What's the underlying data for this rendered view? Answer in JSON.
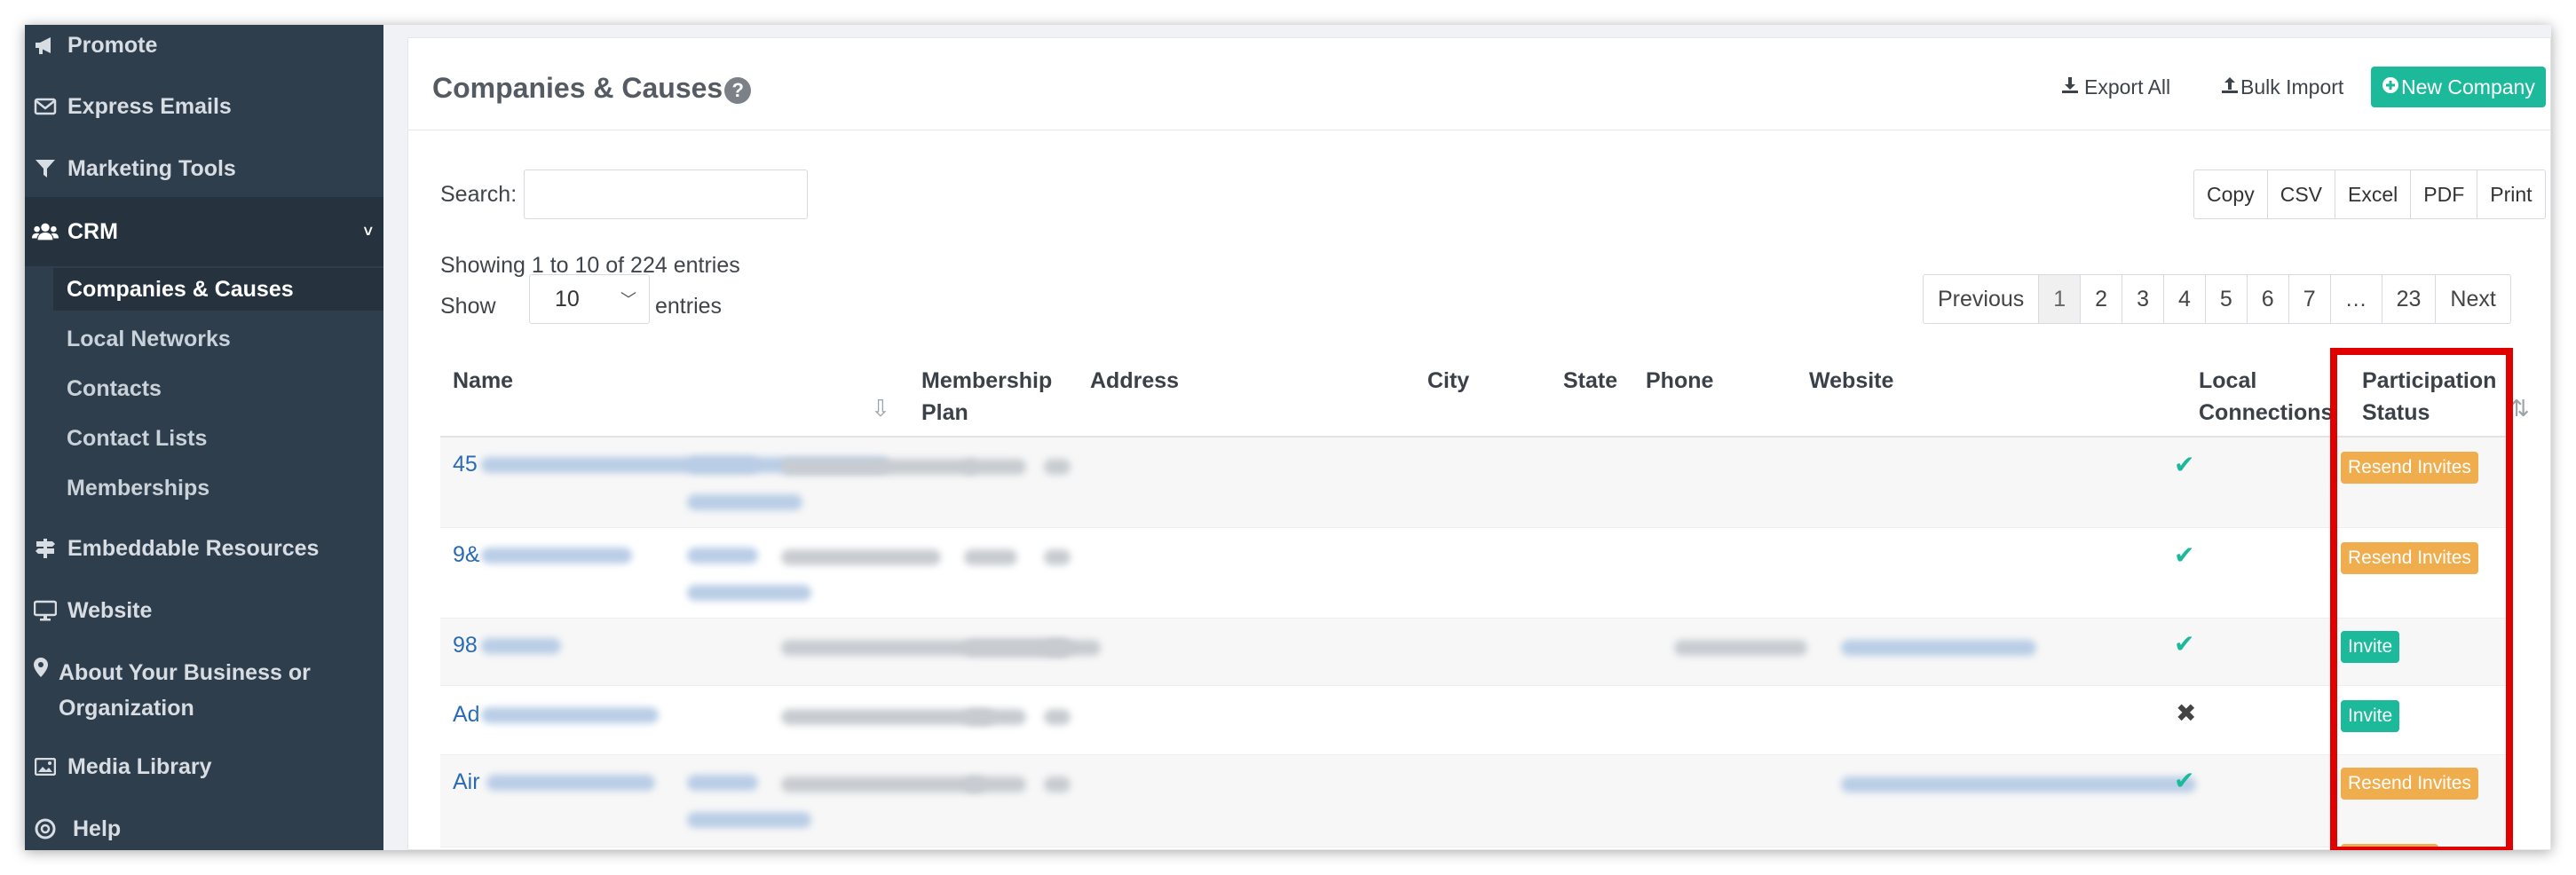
{
  "sidebar": {
    "items": [
      {
        "label": "Promote",
        "icon": "megaphone-icon"
      },
      {
        "label": "Express Emails",
        "icon": "envelope-icon"
      },
      {
        "label": "Marketing Tools",
        "icon": "filter-icon"
      },
      {
        "label": "CRM",
        "icon": "users-icon"
      },
      {
        "label": "Embeddable Resources",
        "icon": "signpost-icon"
      },
      {
        "label": "Website",
        "icon": "monitor-icon"
      },
      {
        "label": "About Your Business or Organization",
        "icon": "map-pin-icon"
      },
      {
        "label": "Media Library",
        "icon": "image-icon"
      },
      {
        "label": "Help",
        "icon": "life-ring-icon"
      }
    ],
    "crm_sub": [
      "Companies & Causes",
      "Local Networks",
      "Contacts",
      "Contact Lists",
      "Memberships"
    ]
  },
  "header": {
    "title": "Companies & Causes",
    "export_all": "Export All",
    "bulk_import": "Bulk Import",
    "new_company": "New Company"
  },
  "controls": {
    "search_label": "Search:",
    "search_value": "",
    "export_buttons": [
      "Copy",
      "CSV",
      "Excel",
      "PDF",
      "Print"
    ],
    "info": "Showing 1 to 10 of 224 entries",
    "show_label": "Show",
    "entries_label": "entries",
    "page_length": "10",
    "pagination": [
      "Previous",
      "1",
      "2",
      "3",
      "4",
      "5",
      "6",
      "7",
      "…",
      "23",
      "Next"
    ],
    "current_page": "1"
  },
  "table": {
    "columns": {
      "name": "Name",
      "membership_line1": "Membership",
      "membership_line2": "Plan",
      "address": "Address",
      "city": "City",
      "state": "State",
      "phone": "Phone",
      "website": "Website",
      "local_line1": "Local",
      "local_line2": "Connections",
      "status_line1": "Participation",
      "status_line2": "Status"
    },
    "rows": [
      {
        "name_prefix": "45",
        "local": "check",
        "status": "Resend Invites"
      },
      {
        "name_prefix": "9&",
        "local": "check",
        "status": "Resend Invites"
      },
      {
        "name_prefix": "98",
        "local": "check",
        "status": "Invite"
      },
      {
        "name_prefix": "Ad",
        "local": "cross",
        "status": "Invite"
      },
      {
        "name_prefix": "Air",
        "local": "check",
        "status": "Resend Invites"
      }
    ]
  },
  "colors": {
    "sidebar_bg": "#2f3e4c",
    "primary": "#1cb99a",
    "badge_orange": "#f0ad4e",
    "highlight": "#e10000"
  }
}
